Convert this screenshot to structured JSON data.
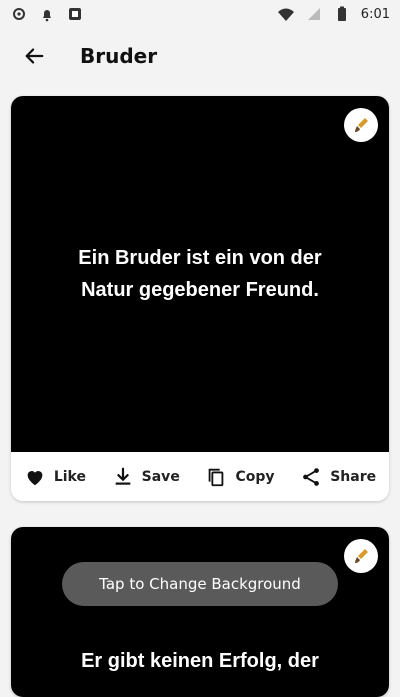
{
  "status_bar": {
    "time": "6:01",
    "left_icons": [
      "settings-icon",
      "notification-icon",
      "media-icon"
    ],
    "right_icons": [
      "wifi-icon",
      "signal-icon",
      "battery-icon"
    ]
  },
  "app_bar": {
    "title": "Bruder",
    "back_icon": "back-arrow-icon"
  },
  "cards": [
    {
      "quote": "Ein Bruder ist ein von der Natur gegebener Freund.",
      "actions": [
        {
          "label": "Like",
          "icon": "heart-icon"
        },
        {
          "label": "Save",
          "icon": "download-icon"
        },
        {
          "label": "Copy",
          "icon": "copy-icon"
        },
        {
          "label": "Share",
          "icon": "share-icon"
        }
      ]
    },
    {
      "quote": "Er gibt keinen Erfolg, der"
    }
  ],
  "toast": "Tap to Change Background"
}
